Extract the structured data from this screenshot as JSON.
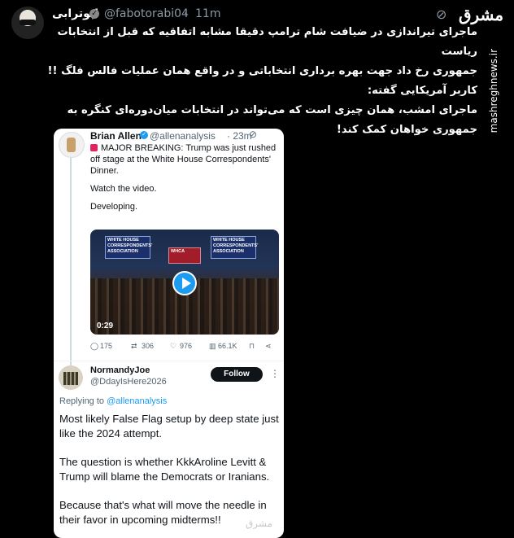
{
  "tweet": {
    "author_name": "ابوترابی",
    "author_handle": "@fabotorabi04",
    "separator": "·",
    "time": "11m",
    "lines": [
      "ماجرای تیراندازی در ضیافت شام ترامپ دقیقا مشابه اتفاقیه که قبل از انتخابات ریاست",
      "جمهوری رخ داد جهت بهره برداری انتخاباتی و در واقع همان عملیات فالس فلگ !!",
      "کاربر آمریکایی گفته:",
      "ماجرای امشب، همان چیزی است که می‌تواند در انتخابات میان‌دوره‌ای کنگره به",
      "جمهوری خواهان کمک کند!"
    ]
  },
  "brand": {
    "logo_text": "مشرق",
    "watermark": "mashreghnews.ir"
  },
  "embedded": {
    "quoted": {
      "name": "Brian Allen",
      "handle": "@allenanalysis",
      "time": "· 23m",
      "body": [
        "MAJOR BREAKING: Trump was just rushed off stage at the White House Correspondents' Dinner.",
        "Watch the video.",
        "Developing."
      ],
      "video": {
        "duration": "0:29",
        "banner_left": "WHITE HOUSE CORRESPONDENTS' ASSOCIATION",
        "banner_right": "WHITE HOUSE CORRESPONDENTS' ASSOCIATION",
        "banner_center": "WHCA"
      },
      "actions": {
        "replies": "175",
        "reposts": "306",
        "likes": "976",
        "views": "66.1K"
      }
    },
    "reply": {
      "name": "NormandyJoe",
      "handle": "@DdayIsHere2026",
      "follow_label": "Follow",
      "replying_prefix": "Replying to ",
      "replying_to": "@allenanalysis",
      "paragraphs": [
        "Most likely False Flag setup by deep state just like the 2024 attempt.",
        "The question is whether KkkAroline Levitt & Trump will blame the Democrats or Iranians.",
        "Because that's what will move the needle in their favor in upcoming midterms!!"
      ],
      "watermark": "مشرق"
    }
  }
}
